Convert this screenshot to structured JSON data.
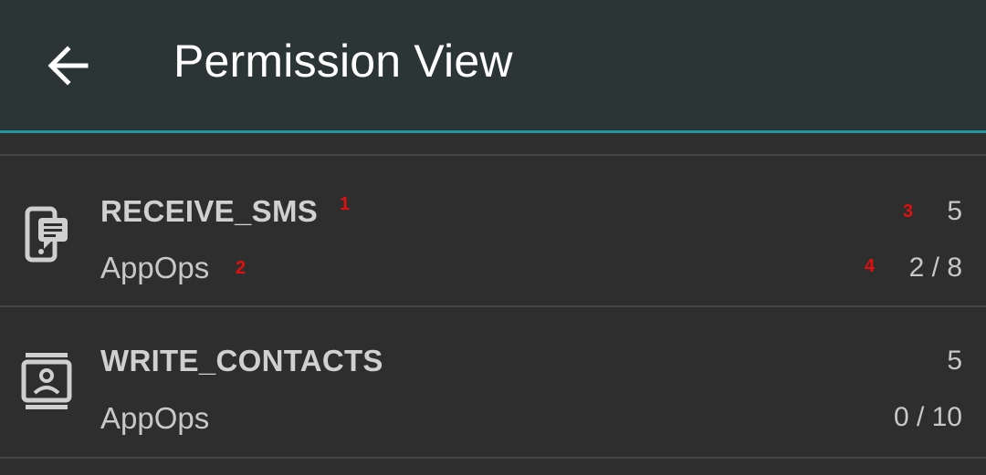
{
  "toolbar": {
    "title": "Permission View",
    "back_icon": "arrow-back-icon"
  },
  "colors": {
    "toolbar_bg": "#2c3536",
    "accent": "#1f9a9f",
    "list_bg": "#2e2e2e",
    "primary_text": "#d0d0d0",
    "marker": "#e01010"
  },
  "permissions": [
    {
      "name": "RECEIVE_SMS",
      "type": "AppOps",
      "count": "5",
      "ratio": "2 / 8",
      "icon": "sms-phone-icon",
      "markers": [
        "1",
        "2",
        "3",
        "4"
      ]
    },
    {
      "name": "WRITE_CONTACTS",
      "type": "AppOps",
      "count": "5",
      "ratio": "0 / 10",
      "icon": "contact-card-icon"
    }
  ]
}
